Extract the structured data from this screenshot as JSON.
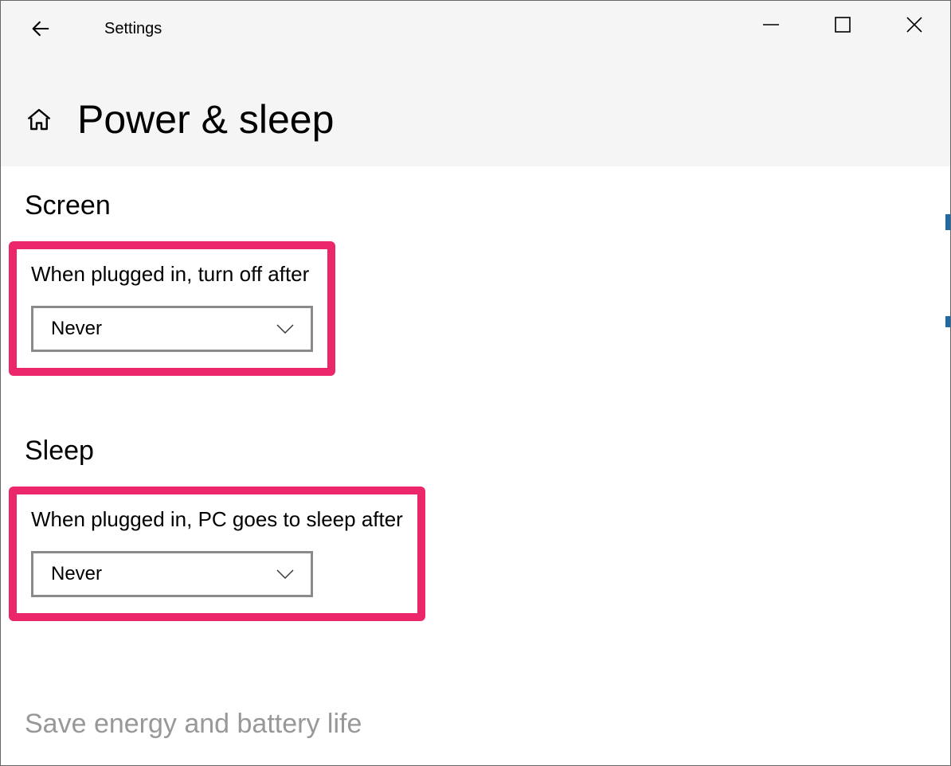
{
  "titlebar": {
    "app_title": "Settings"
  },
  "header": {
    "page_title": "Power & sleep"
  },
  "screen_section": {
    "heading": "Screen",
    "label": "When plugged in, turn off after",
    "value": "Never"
  },
  "sleep_section": {
    "heading": "Sleep",
    "label": "When plugged in, PC goes to sleep after",
    "value": "Never"
  },
  "footer": {
    "heading": "Save energy and battery life"
  }
}
